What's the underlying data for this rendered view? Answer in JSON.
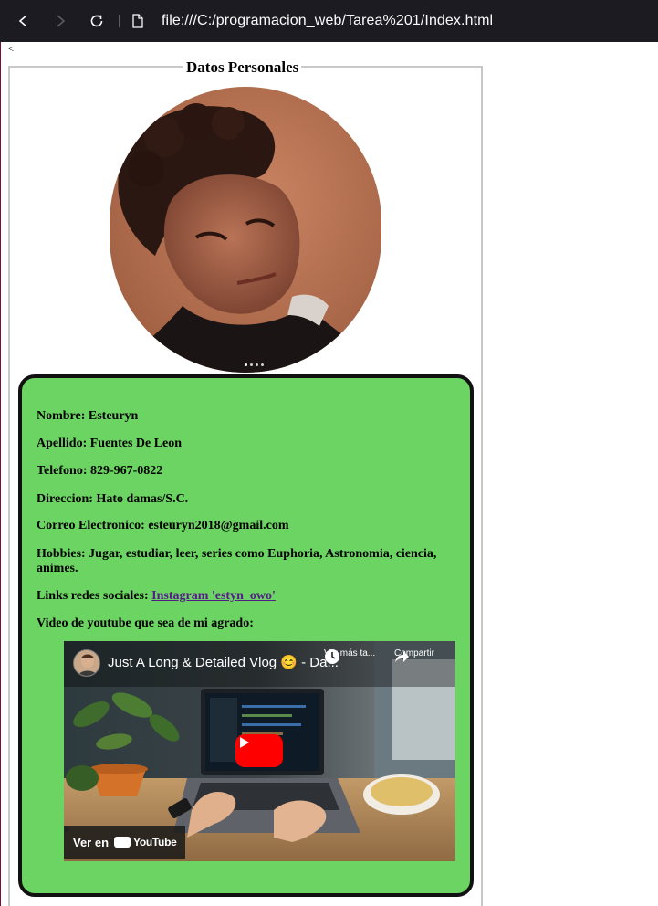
{
  "browser": {
    "url": "file:///C:/programacion_web/Tarea%201/Index.html",
    "back_icon": "back-arrow-icon",
    "forward_icon": "forward-arrow-icon",
    "reload_icon": "reload-icon",
    "page_icon": "file-icon"
  },
  "stray_text": "<",
  "fieldset": {
    "legend": "Datos Personales"
  },
  "info": {
    "nombre": "Nombre: Esteuryn",
    "apellido": "Apellido: Fuentes De Leon",
    "telefono": "Telefono: 829-967-0822",
    "direccion": "Direccion: Hato damas/S.C.",
    "correo": "Correo Electronico: esteuryn2018@gmail.com",
    "hobbies": "Hobbies: Jugar, estudiar, leer, series como Euphoria, Astronomia, ciencia, animes.",
    "links_label": "Links redes sociales: ",
    "instagram_link": "Instagram 'estyn_owo'",
    "video_label": "Video de youtube que sea de mi agrado:"
  },
  "video": {
    "title": "Just A Long & Detailed Vlog 😊 - Da...",
    "watch_later": "Ver más ta...",
    "share": "Compartir",
    "watch_on": "Ver en",
    "youtube": "YouTube"
  },
  "colors": {
    "card_bg": "#6cd462",
    "card_border": "#111111",
    "link": "#551a8b",
    "play_button": "#ff0000"
  }
}
